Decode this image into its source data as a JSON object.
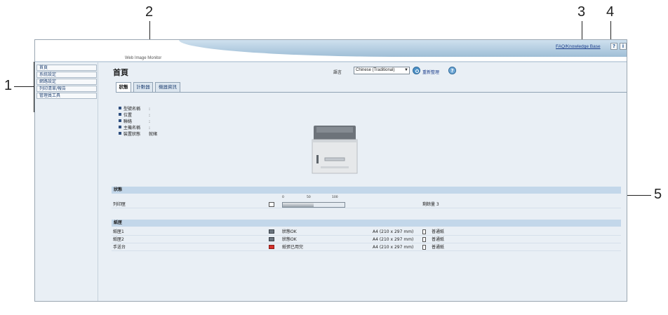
{
  "callouts": [
    "1",
    "2",
    "3",
    "4",
    "5"
  ],
  "header": {
    "app_title": "Web Image Monitor",
    "faq_link": "FAQ/Knowledge Base",
    "help_icon": "?",
    "info_icon": "i"
  },
  "sidebar": {
    "items": [
      {
        "label": "首頁"
      },
      {
        "label": "系統設定"
      },
      {
        "label": "網路設定"
      },
      {
        "label": "列印清單/報告"
      },
      {
        "label": "管理員工具"
      }
    ]
  },
  "main": {
    "page_title": "首頁",
    "language_label": "語言",
    "language_value": "Chinese (Traditional)",
    "refresh_label": "重新整理",
    "tabs": [
      {
        "label": "狀態",
        "active": true
      },
      {
        "label": "計數器",
        "active": false
      },
      {
        "label": "機器資訊",
        "active": false
      }
    ],
    "info": [
      {
        "label": "型號名稱",
        "value": ":"
      },
      {
        "label": "位置",
        "value": ":"
      },
      {
        "label": "聯絡",
        "value": ":"
      },
      {
        "label": "主機名稱",
        "value": ":"
      },
      {
        "label": "裝置狀態",
        "value": "就緒"
      }
    ]
  },
  "status_section": {
    "header": "狀態",
    "toner": {
      "label": "列印匣",
      "scale": [
        "0",
        "50",
        "100"
      ],
      "level_percent": 50,
      "remaining_text": "剩餘量 3"
    }
  },
  "trays_section": {
    "header": "紙匣",
    "rows": [
      {
        "name": "紙匣1",
        "status": "狀態OK",
        "size": "A4 (210 x 297 mm)",
        "type": "普通紙",
        "icon_color": "#6b7580"
      },
      {
        "name": "紙匣2",
        "status": "狀態OK",
        "size": "A4 (210 x 297 mm)",
        "type": "普通紙",
        "icon_color": "#6b7580"
      },
      {
        "name": "手送台",
        "status": "紙張已用完",
        "size": "A4 (210 x 297 mm)",
        "type": "普通紙",
        "icon_color": "#d6322c"
      }
    ]
  }
}
